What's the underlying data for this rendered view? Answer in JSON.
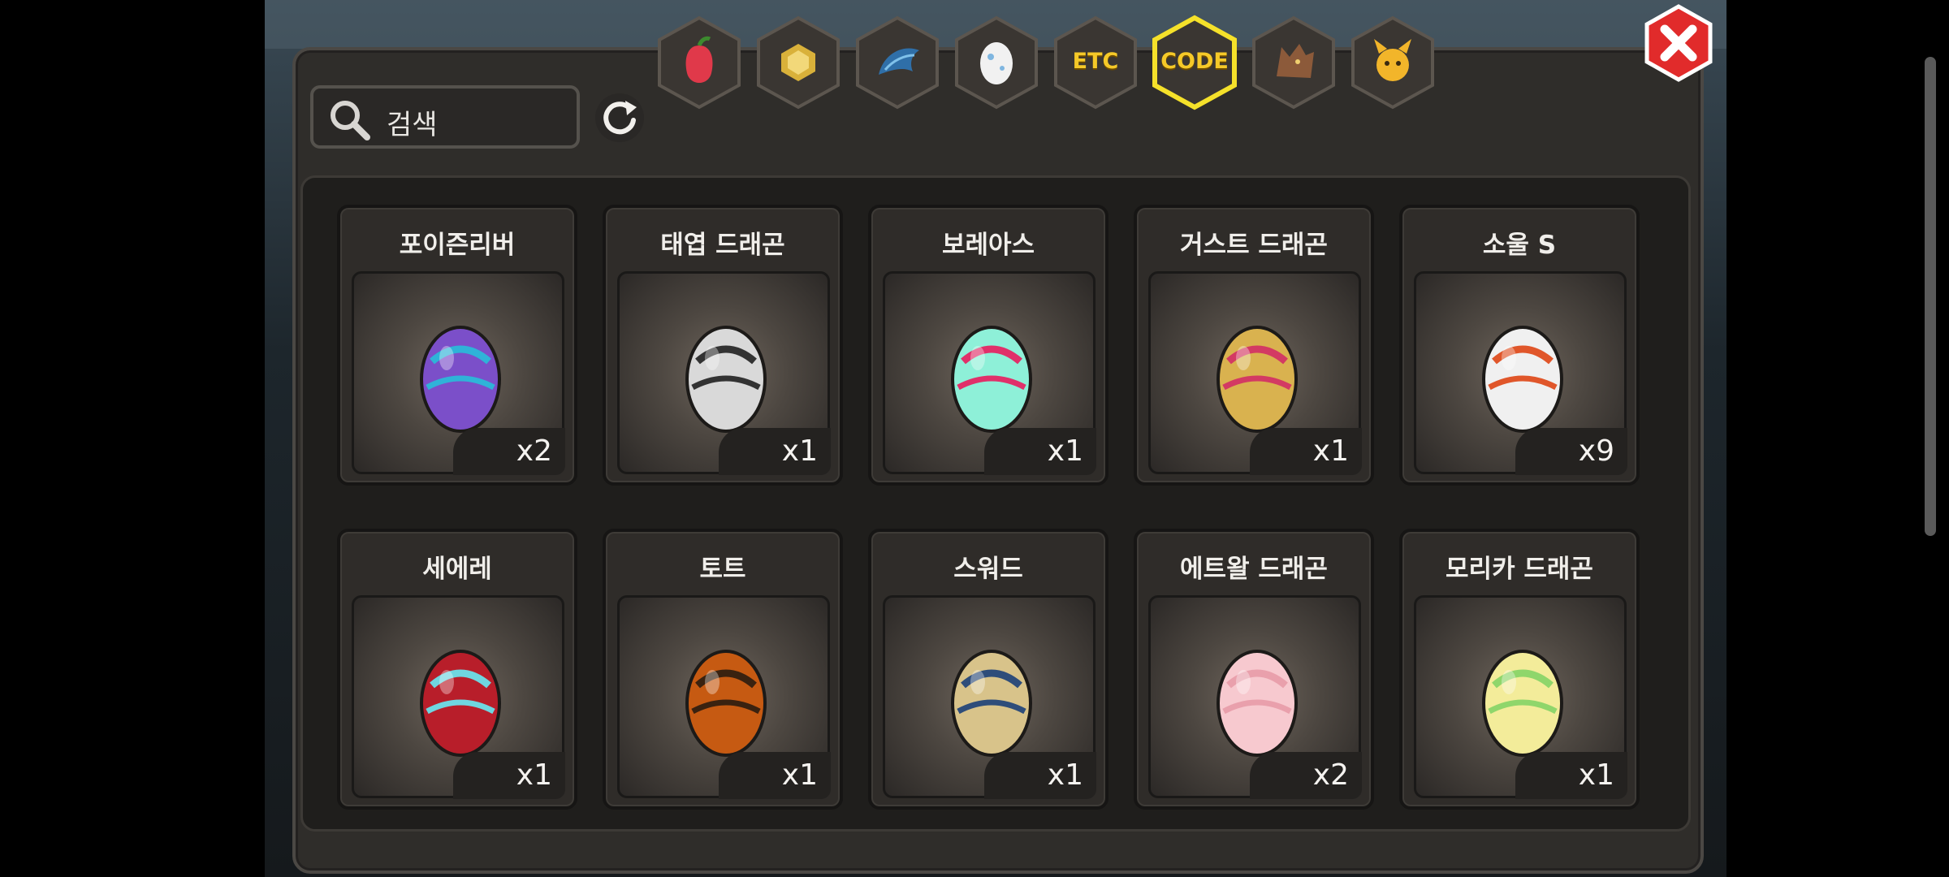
{
  "search": {
    "placeholder": "검색"
  },
  "tabs": [
    {
      "name": "fruit",
      "icon": "fruit-icon",
      "label": ""
    },
    {
      "name": "gold",
      "icon": "gold-ore-icon",
      "label": ""
    },
    {
      "name": "dragon-wing",
      "icon": "dragon-wing-icon",
      "label": ""
    },
    {
      "name": "egg",
      "icon": "egg-icon",
      "label": ""
    },
    {
      "name": "etc",
      "icon": "",
      "label": "ETC"
    },
    {
      "name": "code",
      "icon": "",
      "label": "CODE",
      "selected": true
    },
    {
      "name": "beast",
      "icon": "wolf-icon",
      "label": ""
    },
    {
      "name": "pet",
      "icon": "horned-face-icon",
      "label": ""
    }
  ],
  "items": [
    {
      "name": "포이즌리버",
      "qty": "x2",
      "icon": "purple-striped-egg-icon",
      "colors": [
        "#7b4fc9",
        "#2fb3d8"
      ]
    },
    {
      "name": "태엽 드래곤",
      "qty": "x1",
      "icon": "windup-egg-icon",
      "colors": [
        "#d9d9d9",
        "#333333"
      ]
    },
    {
      "name": "보레아스",
      "qty": "x1",
      "icon": "winged-crystal-egg-icon",
      "colors": [
        "#8ef0d8",
        "#e0306a"
      ]
    },
    {
      "name": "거스트 드래곤",
      "qty": "x1",
      "icon": "crested-egg-icon",
      "colors": [
        "#d9b24f",
        "#d33a63"
      ]
    },
    {
      "name": "소울 S",
      "qty": "x9",
      "icon": "flame-wing-egg-icon",
      "colors": [
        "#f0f0f0",
        "#e0562a"
      ]
    },
    {
      "name": "세에레",
      "qty": "x1",
      "icon": "hooded-demon-egg-icon",
      "colors": [
        "#b81e2a",
        "#6fd6e0"
      ]
    },
    {
      "name": "토트",
      "qty": "x1",
      "icon": "armored-fire-egg-icon",
      "colors": [
        "#c65a12",
        "#3a2210"
      ]
    },
    {
      "name": "스워드",
      "qty": "x1",
      "icon": "knight-egg-icon",
      "colors": [
        "#d8c38a",
        "#2e4d7a"
      ]
    },
    {
      "name": "에트왈 드래곤",
      "qty": "x2",
      "icon": "lotus-egg-icon",
      "colors": [
        "#f7c9cf",
        "#e9a0ac"
      ]
    },
    {
      "name": "모리카 드래곤",
      "qty": "x1",
      "icon": "star-ribbon-egg-icon",
      "colors": [
        "#f3ec9a",
        "#8fd66b"
      ]
    }
  ]
}
